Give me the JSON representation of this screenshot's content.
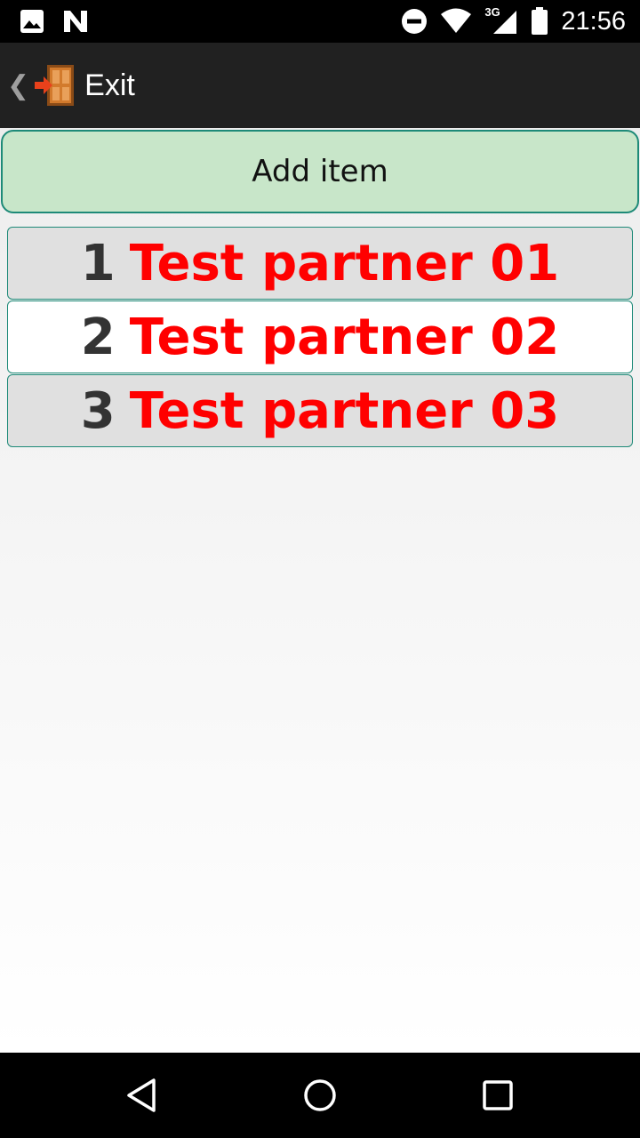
{
  "status_bar": {
    "time": "21:56",
    "network_type": "3G",
    "icons": [
      "image-icon",
      "n-notification-icon",
      "do-not-disturb-icon",
      "wifi-icon",
      "cell-signal-icon",
      "battery-icon"
    ]
  },
  "action_bar": {
    "back_icon": "chevron-left-icon",
    "app_icon": "exit-door-icon",
    "title": "Exit"
  },
  "main": {
    "add_button_label": "Add item",
    "items": [
      {
        "number": "1",
        "name": "Test partner 01"
      },
      {
        "number": "2",
        "name": "Test partner 02"
      },
      {
        "number": "3",
        "name": "Test partner 03"
      }
    ]
  },
  "nav_bar": {
    "buttons": [
      "back-icon",
      "home-icon",
      "recents-icon"
    ]
  },
  "colors": {
    "add_button_bg": "#c8e6c9",
    "border_accent": "#1e8a78",
    "item_name": "#ff0000",
    "item_number": "#333333",
    "action_bar_bg": "#212121"
  }
}
